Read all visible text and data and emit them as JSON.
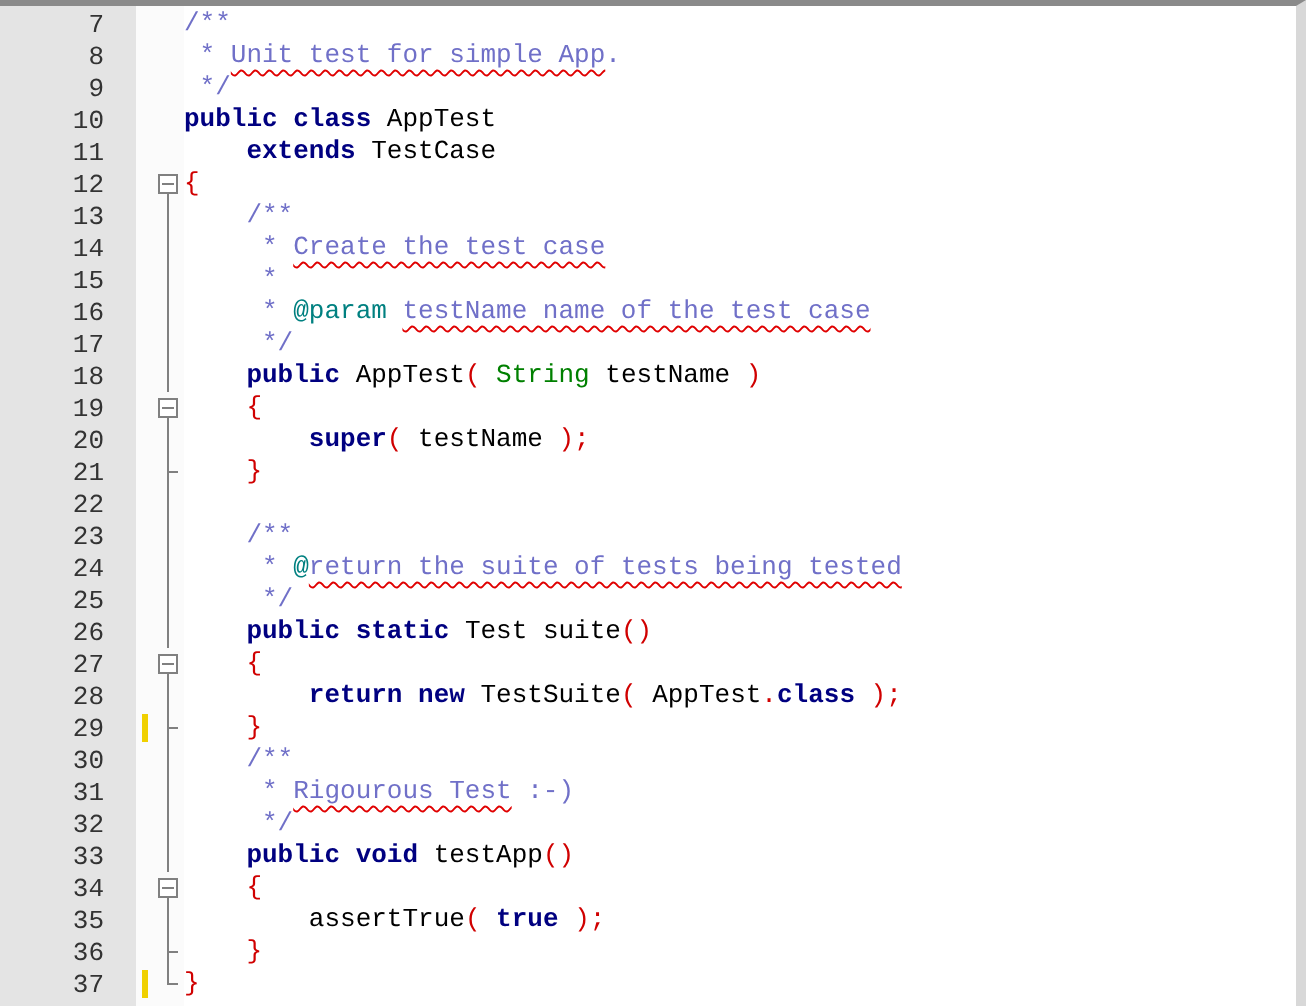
{
  "editor": {
    "lines": [
      {
        "number": "7",
        "kind": "plain",
        "changed": false,
        "tokens": [
          {
            "kind": "comment",
            "text": "/**"
          }
        ]
      },
      {
        "number": "8",
        "kind": "plain",
        "changed": false,
        "tokens": [
          {
            "kind": "comment",
            "text": " * "
          },
          {
            "kind": "spell",
            "text": "Unit test for simple App"
          },
          {
            "kind": "comment",
            "text": "."
          }
        ]
      },
      {
        "number": "9",
        "kind": "plain",
        "changed": false,
        "tokens": [
          {
            "kind": "comment",
            "text": " */"
          }
        ]
      },
      {
        "number": "10",
        "kind": "plain",
        "changed": false,
        "tokens": [
          {
            "kind": "keyword",
            "text": "public class "
          },
          {
            "kind": "plain",
            "text": "AppTest"
          }
        ]
      },
      {
        "number": "11",
        "kind": "plain",
        "changed": false,
        "tokens": [
          {
            "kind": "keyword",
            "text": "    extends "
          },
          {
            "kind": "plain",
            "text": "TestCase"
          }
        ]
      },
      {
        "number": "12",
        "kind": "fold_open",
        "changed": false,
        "tokens": [
          {
            "kind": "operator",
            "text": "{"
          }
        ]
      },
      {
        "number": "13",
        "kind": "fold_line",
        "changed": false,
        "tokens": [
          {
            "kind": "comment",
            "text": "    /**"
          }
        ]
      },
      {
        "number": "14",
        "kind": "fold_line",
        "changed": false,
        "tokens": [
          {
            "kind": "comment",
            "text": "     * "
          },
          {
            "kind": "spell",
            "text": "Create the test case"
          }
        ]
      },
      {
        "number": "15",
        "kind": "fold_line",
        "changed": false,
        "tokens": [
          {
            "kind": "comment",
            "text": "     *"
          }
        ]
      },
      {
        "number": "16",
        "kind": "fold_line",
        "changed": false,
        "tokens": [
          {
            "kind": "comment",
            "text": "     * "
          },
          {
            "kind": "tag",
            "text": "@param "
          },
          {
            "kind": "spell",
            "text": "testName name of the test case"
          }
        ]
      },
      {
        "number": "17",
        "kind": "fold_line",
        "changed": false,
        "tokens": [
          {
            "kind": "comment",
            "text": "     */"
          }
        ]
      },
      {
        "number": "18",
        "kind": "fold_line",
        "changed": false,
        "tokens": [
          {
            "kind": "keyword",
            "text": "    public "
          },
          {
            "kind": "plain",
            "text": "AppTest"
          },
          {
            "kind": "operator",
            "text": "( "
          },
          {
            "kind": "type",
            "text": "String"
          },
          {
            "kind": "plain",
            "text": " testName "
          },
          {
            "kind": "operator",
            "text": ")"
          }
        ]
      },
      {
        "number": "19",
        "kind": "fold_open",
        "changed": false,
        "tokens": [
          {
            "kind": "operator",
            "text": "    {"
          }
        ]
      },
      {
        "number": "20",
        "kind": "fold_line",
        "changed": false,
        "tokens": [
          {
            "kind": "keyword",
            "text": "        super"
          },
          {
            "kind": "operator",
            "text": "( "
          },
          {
            "kind": "plain",
            "text": "testName "
          },
          {
            "kind": "operator",
            "text": ");"
          }
        ]
      },
      {
        "number": "21",
        "kind": "fold_end",
        "changed": false,
        "tokens": [
          {
            "kind": "operator",
            "text": "    }"
          }
        ]
      },
      {
        "number": "22",
        "kind": "fold_line",
        "changed": false
      },
      {
        "number": "23",
        "kind": "fold_line",
        "changed": false,
        "tokens": [
          {
            "kind": "comment",
            "text": "    /**"
          }
        ]
      },
      {
        "number": "24",
        "kind": "fold_line",
        "changed": false,
        "tokens": [
          {
            "kind": "comment",
            "text": "     * "
          },
          {
            "kind": "tag",
            "text": "@"
          },
          {
            "kind": "spell",
            "text": "return the suite of tests being tested"
          }
        ]
      },
      {
        "number": "25",
        "kind": "fold_line",
        "changed": false,
        "tokens": [
          {
            "kind": "comment",
            "text": "     */"
          }
        ]
      },
      {
        "number": "26",
        "kind": "fold_line",
        "changed": false,
        "tokens": [
          {
            "kind": "keyword",
            "text": "    public static "
          },
          {
            "kind": "plain",
            "text": "Test suite"
          },
          {
            "kind": "operator",
            "text": "()"
          }
        ]
      },
      {
        "number": "27",
        "kind": "fold_open",
        "changed": false,
        "tokens": [
          {
            "kind": "operator",
            "text": "    {"
          }
        ]
      },
      {
        "number": "28",
        "kind": "fold_line",
        "changed": false,
        "tokens": [
          {
            "kind": "keyword",
            "text": "        return new "
          },
          {
            "kind": "plain",
            "text": "TestSuite"
          },
          {
            "kind": "operator",
            "text": "( "
          },
          {
            "kind": "plain",
            "text": "AppTest"
          },
          {
            "kind": "operator",
            "text": "."
          },
          {
            "kind": "keyword",
            "text": "class "
          },
          {
            "kind": "operator",
            "text": ");"
          }
        ]
      },
      {
        "number": "29",
        "kind": "fold_end",
        "changed": true,
        "tokens": [
          {
            "kind": "operator",
            "text": "    }"
          }
        ]
      },
      {
        "number": "30",
        "kind": "fold_line",
        "changed": false,
        "tokens": [
          {
            "kind": "comment",
            "text": "    /**"
          }
        ]
      },
      {
        "number": "31",
        "kind": "fold_line",
        "changed": false,
        "tokens": [
          {
            "kind": "comment",
            "text": "     * "
          },
          {
            "kind": "spell",
            "text": "Rigourous Test"
          },
          {
            "kind": "comment",
            "text": " :-)"
          }
        ]
      },
      {
        "number": "32",
        "kind": "fold_line",
        "changed": false,
        "tokens": [
          {
            "kind": "comment",
            "text": "     */"
          }
        ]
      },
      {
        "number": "33",
        "kind": "fold_line",
        "changed": false,
        "tokens": [
          {
            "kind": "keyword",
            "text": "    public void "
          },
          {
            "kind": "plain",
            "text": "testApp"
          },
          {
            "kind": "operator",
            "text": "()"
          }
        ]
      },
      {
        "number": "34",
        "kind": "fold_open",
        "changed": false,
        "tokens": [
          {
            "kind": "operator",
            "text": "    {"
          }
        ]
      },
      {
        "number": "35",
        "kind": "fold_line",
        "changed": false,
        "tokens": [
          {
            "kind": "plain",
            "text": "        assertTrue"
          },
          {
            "kind": "operator",
            "text": "( "
          },
          {
            "kind": "keyword",
            "text": "true "
          },
          {
            "kind": "operator",
            "text": ");"
          }
        ]
      },
      {
        "number": "36",
        "kind": "fold_end",
        "changed": false,
        "tokens": [
          {
            "kind": "operator",
            "text": "    }"
          }
        ]
      },
      {
        "number": "37",
        "kind": "fold_close",
        "changed": true,
        "tokens": [
          {
            "kind": "operator",
            "text": "}"
          }
        ]
      }
    ]
  }
}
